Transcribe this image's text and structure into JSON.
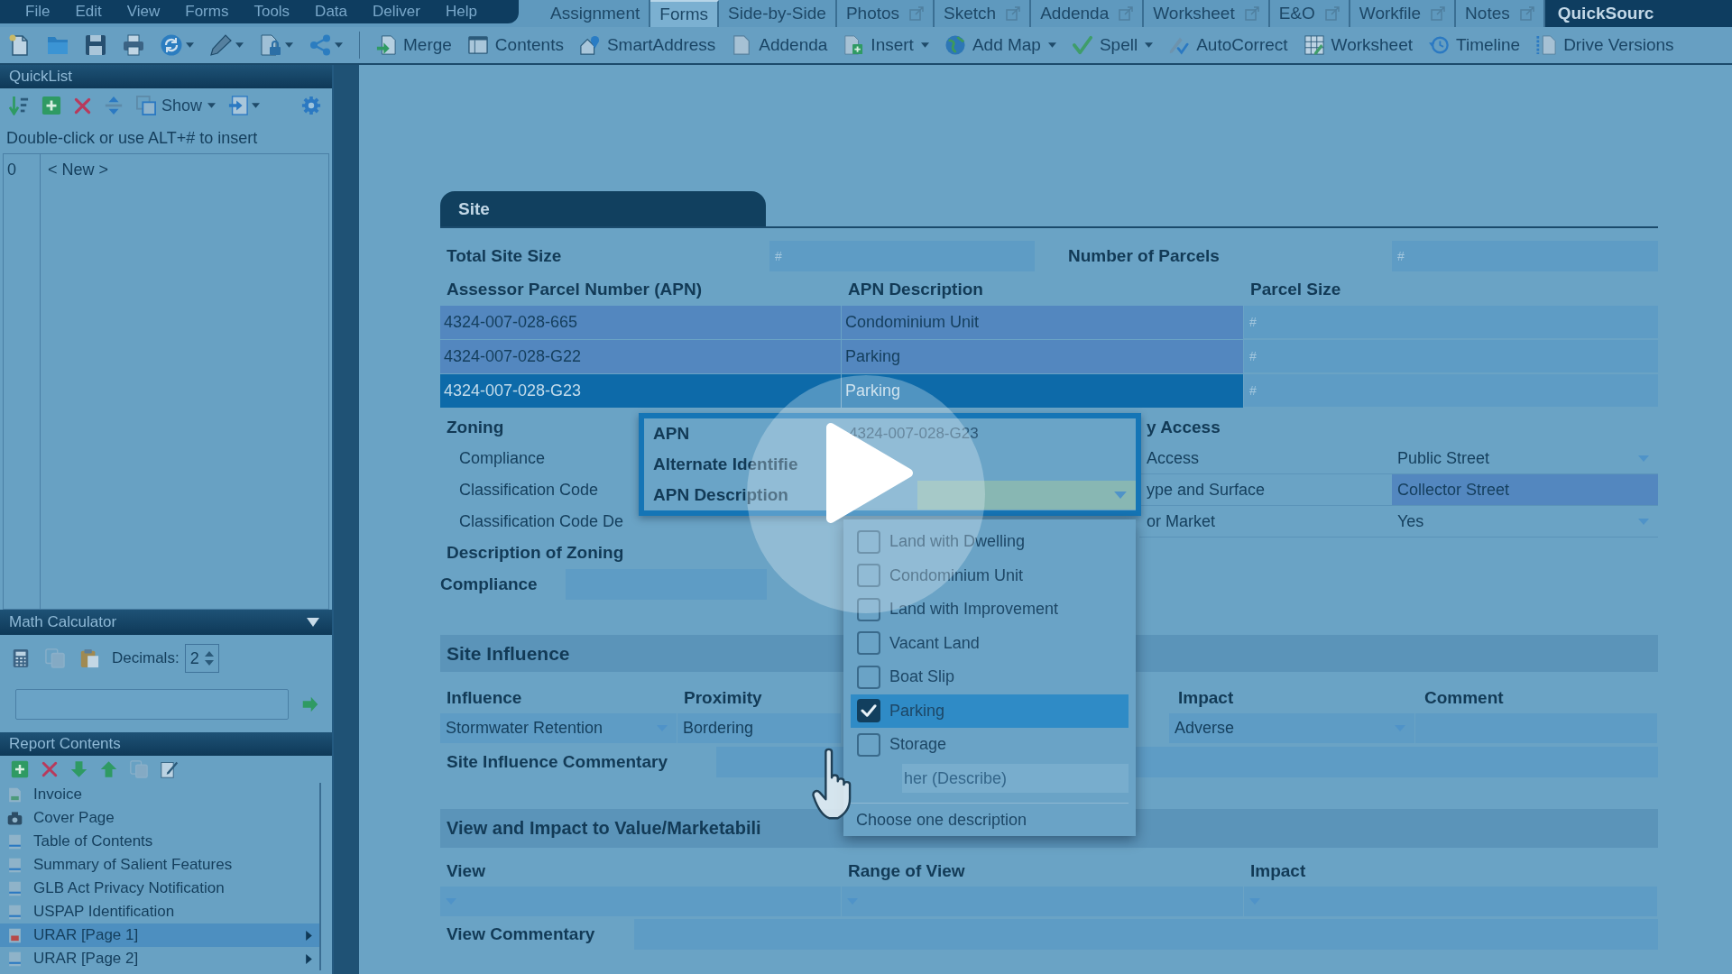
{
  "menu_bar": [
    "File",
    "Edit",
    "View",
    "Forms",
    "Tools",
    "Data",
    "Deliver",
    "Help"
  ],
  "tabs": [
    {
      "label": "Assignment",
      "selected": false,
      "popout": false
    },
    {
      "label": "Forms",
      "selected": true,
      "popout": false
    },
    {
      "label": "Side-by-Side",
      "selected": false,
      "popout": false
    },
    {
      "label": "Photos",
      "selected": false,
      "popout": true
    },
    {
      "label": "Sketch",
      "selected": false,
      "popout": true
    },
    {
      "label": "Addenda",
      "selected": false,
      "popout": true
    },
    {
      "label": "Worksheet",
      "selected": false,
      "popout": true
    },
    {
      "label": "E&O",
      "selected": false,
      "popout": true
    },
    {
      "label": "Workfile",
      "selected": false,
      "popout": true
    },
    {
      "label": "Notes",
      "selected": false,
      "popout": true
    }
  ],
  "quicksource_tab": "QuickSourc",
  "toolbar": [
    {
      "label": "Merge",
      "menu": false
    },
    {
      "label": "Contents",
      "menu": false
    },
    {
      "label": "SmartAddress",
      "menu": false
    },
    {
      "label": "Addenda",
      "menu": false
    },
    {
      "label": "Insert",
      "menu": true
    },
    {
      "label": "Add Map",
      "menu": true
    },
    {
      "label": "Spell",
      "menu": true
    },
    {
      "label": "AutoCorrect",
      "menu": false
    },
    {
      "label": "Worksheet",
      "menu": false
    },
    {
      "label": "Timeline",
      "menu": false
    },
    {
      "label": "Drive Versions",
      "menu": false
    }
  ],
  "quicklist": {
    "title": "QuickList",
    "show": "Show",
    "hint": "Double-click or use ALT+# to insert",
    "rows": [
      {
        "number": "0",
        "text": "< New >"
      }
    ]
  },
  "math_calculator": {
    "title": "Math Calculator",
    "decimals_label": "Decimals:",
    "decimals": "2"
  },
  "report_contents": {
    "title": "Report Contents",
    "items": [
      {
        "label": "Invoice",
        "kind": "invoice",
        "selected": false,
        "expandable": false
      },
      {
        "label": "Cover Page",
        "kind": "cover",
        "selected": false,
        "expandable": false
      },
      {
        "label": "Table of Contents",
        "kind": "page",
        "selected": false,
        "expandable": false
      },
      {
        "label": "Summary of Salient Features",
        "kind": "page",
        "selected": false,
        "expandable": false
      },
      {
        "label": "GLB Act Privacy Notification",
        "kind": "page",
        "selected": false,
        "expandable": false
      },
      {
        "label": "USPAP Identification",
        "kind": "page",
        "selected": false,
        "expandable": false
      },
      {
        "label": "URAR [Page 1]",
        "kind": "form",
        "selected": true,
        "expandable": true
      },
      {
        "label": "URAR [Page 2]",
        "kind": "page",
        "selected": false,
        "expandable": true
      }
    ]
  },
  "site": {
    "title": "Site",
    "total_site_size": {
      "label": "Total Site Size",
      "placeholder": "#"
    },
    "number_of_parcels": {
      "label": "Number of Parcels",
      "placeholder": "#"
    },
    "parcels": {
      "columns": [
        "Assessor Parcel Number (APN)",
        "APN Description",
        "Parcel Size"
      ],
      "rows": [
        {
          "apn": "4324-007-028-665",
          "description": "Condominium Unit",
          "size_placeholder": "#",
          "highlighted": true,
          "selected": false
        },
        {
          "apn": "4324-007-028-G22",
          "description": "Parking",
          "size_placeholder": "#",
          "highlighted": true,
          "selected": false
        },
        {
          "apn": "4324-007-028-G23",
          "description": "Parking",
          "size_placeholder": "#",
          "highlighted": false,
          "selected": true
        }
      ]
    },
    "zoning": {
      "title": "Zoning",
      "rows": [
        "Compliance",
        "Classification Code",
        "Classification Code De"
      ]
    },
    "access": {
      "title": "y Access",
      "rows": [
        {
          "label": "Access",
          "value": "Public Street",
          "dropdown": true,
          "highlighted": false
        },
        {
          "label": "ype and Surface",
          "value": "Collector Street",
          "dropdown": false,
          "highlighted": true
        },
        {
          "label": "or Market",
          "value": "Yes",
          "dropdown": true,
          "highlighted": false
        }
      ]
    },
    "zoning_description": {
      "heading": "Description of Zoning",
      "label": "Compliance"
    }
  },
  "site_influence": {
    "title": "Site Influence",
    "columns": [
      "Influence",
      "Proximity",
      "Impact",
      "Comment"
    ],
    "rows": [
      {
        "cells": [
          {
            "value": "Stormwater Retention",
            "dropdown": true
          },
          {
            "value": "Bordering",
            "dropdown": false
          },
          {
            "value": "Adverse",
            "dropdown": true
          },
          {
            "dropdown": false
          }
        ]
      }
    ],
    "commentary_label": "Site Influence Commentary"
  },
  "view_impact": {
    "title": "View and Impact to Value/Marketabili",
    "columns": [
      "View",
      "Range of View",
      "Impact"
    ],
    "rows": [
      {
        "cells": [
          {
            "dropdown": true
          },
          {
            "dropdown": true
          },
          {
            "dropdown": true
          }
        ]
      }
    ],
    "commentary_label": "View Commentary"
  },
  "apn_popup": {
    "rows": [
      {
        "label": "APN",
        "value": "4324-007-028-G23",
        "kind": "text"
      },
      {
        "label": "Alternate Identifie",
        "kind": "text"
      },
      {
        "label": "APN Description",
        "kind": "dropdown"
      }
    ]
  },
  "description_list": {
    "items": [
      {
        "label": "Land with Dwelling",
        "kind": "checkbox",
        "checked": false,
        "selected": false
      },
      {
        "label": "Condominium Unit",
        "kind": "checkbox",
        "checked": false,
        "selected": false
      },
      {
        "label": "Land with Improvement",
        "kind": "checkbox",
        "checked": false,
        "selected": false
      },
      {
        "label": "Vacant Land",
        "kind": "checkbox",
        "checked": false,
        "selected": false
      },
      {
        "label": "Boat Slip",
        "kind": "checkbox",
        "checked": false,
        "selected": false
      },
      {
        "label": "Parking",
        "kind": "checkbox",
        "checked": true,
        "selected": true
      },
      {
        "label": "Storage",
        "kind": "checkbox",
        "checked": false,
        "selected": false
      },
      {
        "label": "her (Describe)",
        "kind": "entry",
        "selected": false
      }
    ],
    "footer": "Choose one description"
  }
}
